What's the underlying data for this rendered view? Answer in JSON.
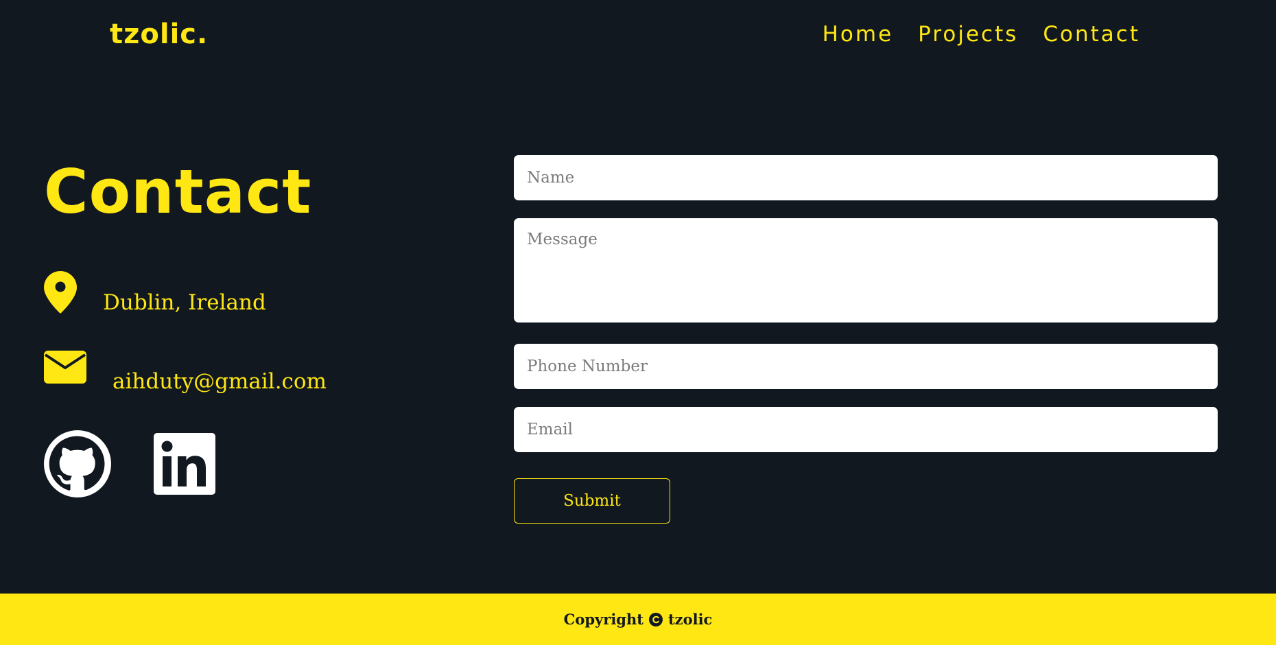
{
  "header": {
    "brand": "tzolic.",
    "nav": [
      {
        "label": "Home"
      },
      {
        "label": "Projects"
      },
      {
        "label": "Contact"
      }
    ]
  },
  "contact": {
    "title": "Contact",
    "location": {
      "icon": "location-pin-icon",
      "text": "Dublin, Ireland"
    },
    "email": {
      "icon": "envelope-icon",
      "text": "aihduty@gmail.com"
    },
    "socials": [
      {
        "icon": "github-icon"
      },
      {
        "icon": "linkedin-icon"
      }
    ]
  },
  "form": {
    "name_placeholder": "Name",
    "message_placeholder": "Message",
    "phone_placeholder": "Phone Number",
    "email_placeholder": "Email",
    "submit_label": "Submit"
  },
  "footer": {
    "left_text": "Copyright",
    "icon": "copyright-icon",
    "right_text": "tzolic"
  },
  "colors": {
    "background": "#111820",
    "accent": "#ffe713",
    "field": "#ffffff"
  }
}
